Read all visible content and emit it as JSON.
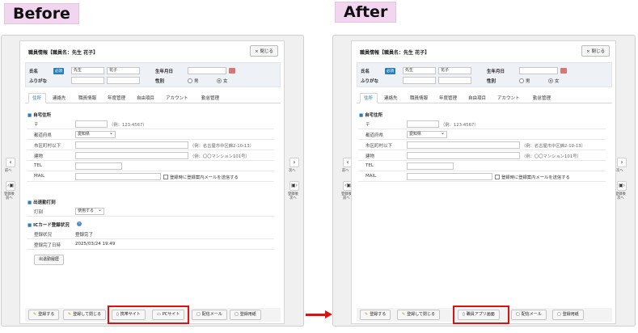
{
  "labels": {
    "before": "Before",
    "after": "After"
  },
  "window": {
    "title": "職員情報【職員名：先生 花子】",
    "close_label": "× 閉じる"
  },
  "info": {
    "name_label": "氏名",
    "name_badge": "必須",
    "last_name": "先生",
    "first_name": "花子",
    "furigana_label": "ふりがな",
    "birth_label": "生年月日",
    "gender_label": "性別",
    "male": "男",
    "female": "女"
  },
  "tabs": [
    "住所",
    "連絡先",
    "職員情報",
    "年度管理",
    "自由項目",
    "アカウント",
    "勤怠管理"
  ],
  "address": {
    "section": "自宅住所",
    "postal_label": "〒",
    "postal_hint": "（例：123-4567）",
    "pref_label": "都道府県",
    "pref_value": "愛知県",
    "city_label": "市区町村以下",
    "city_hint": "（例：名古屋市中区錦2-10-13）",
    "building_label": "建物",
    "building_hint": "（例：〇〇マンション101号）",
    "tel_label": "TEL",
    "mail_label": "MAIL",
    "mail_check": "登録時に登録案内メールを送信する"
  },
  "attendance": {
    "section": "出退勤打刻",
    "punch_label": "打刻",
    "punch_value": "使用する"
  },
  "iccard": {
    "section": "ICカード登録状況",
    "status_label": "登録状況",
    "status_value": "登録完了",
    "date_label": "登録完了日時",
    "date_value": "2025/03/24 19:49",
    "history_button": "出退勤履歴"
  },
  "buttons": {
    "register": "登録する",
    "register_close": "登録して閉じる",
    "mobile_site": "携帯サイト",
    "pc_site": "PCサイト",
    "staff_app": "職員アプリ画面",
    "mail": "配信メール",
    "register_form": "登録用紙"
  },
  "nav": {
    "prev": "前へ",
    "next": "次へ",
    "save_prev": "登録後\n前へ",
    "save_next": "登録後\n次へ"
  },
  "colors": {
    "highlight": "#e01010",
    "accent": "#2b7fb8",
    "label_bg": "#f2d6f0"
  }
}
